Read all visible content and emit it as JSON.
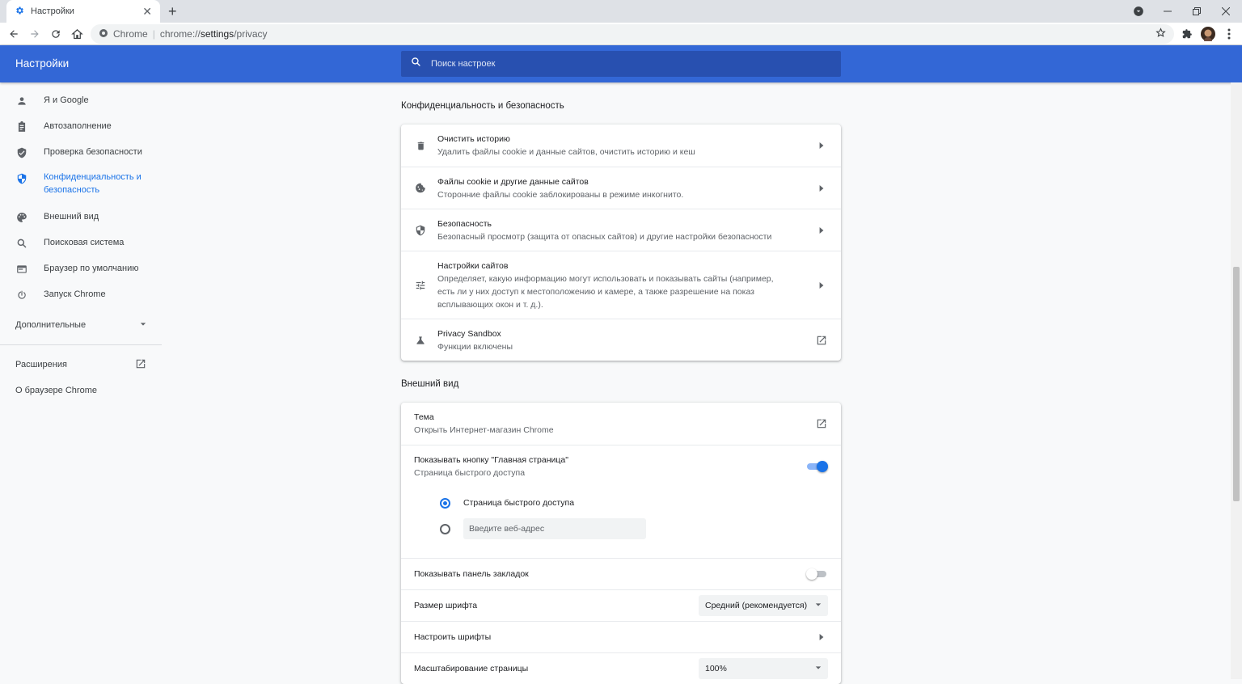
{
  "browser": {
    "tab_title": "Настройки",
    "omnibox_host": "Chrome",
    "omnibox_scheme": "chrome://",
    "omnibox_path_bold": "settings",
    "omnibox_path_rest": "/privacy"
  },
  "header": {
    "title": "Настройки",
    "search_placeholder": "Поиск настроек"
  },
  "sidebar": {
    "items": [
      {
        "label": "Я и Google",
        "icon": "person-icon"
      },
      {
        "label": "Автозаполнение",
        "icon": "clipboard-icon"
      },
      {
        "label": "Проверка безопасности",
        "icon": "shield-check-icon"
      },
      {
        "label": "Конфиденциальность и безопасность",
        "icon": "shield-icon",
        "active": true
      },
      {
        "label": "Внешний вид",
        "icon": "palette-icon"
      },
      {
        "label": "Поисковая система",
        "icon": "search-icon"
      },
      {
        "label": "Браузер по умолчанию",
        "icon": "browser-icon"
      },
      {
        "label": "Запуск Chrome",
        "icon": "power-icon"
      }
    ],
    "advanced": "Дополнительные",
    "extensions": "Расширения",
    "about": "О браузере Chrome"
  },
  "privacy": {
    "title": "Конфиденциальность и безопасность",
    "rows": [
      {
        "primary": "Очистить историю",
        "secondary": "Удалить файлы cookie и данные сайтов, очистить историю и кеш"
      },
      {
        "primary": "Файлы cookie и другие данные сайтов",
        "secondary": "Сторонние файлы cookie заблокированы в режиме инкогнито."
      },
      {
        "primary": "Безопасность",
        "secondary": "Безопасный просмотр (защита от опасных сайтов) и другие настройки безопасности"
      },
      {
        "primary": "Настройки сайтов",
        "secondary": "Определяет, какую информацию могут использовать и показывать сайты (например, есть ли у них доступ к местоположению и камере, а также разрешение на показ всплывающих окон и т. д.)."
      },
      {
        "primary": "Privacy Sandbox",
        "secondary": "Функции включены"
      }
    ]
  },
  "appearance": {
    "title": "Внешний вид",
    "theme_primary": "Тема",
    "theme_secondary": "Открыть Интернет-магазин Chrome",
    "home_primary": "Показывать кнопку \"Главная страница\"",
    "home_secondary": "Страница быстрого доступа",
    "home_toggle_on": true,
    "radio_ntp": "Страница быстрого доступа",
    "radio_url_placeholder": "Введите веб-адрес",
    "bookmarks_bar": "Показывать панель закладок",
    "bookmarks_toggle_on": false,
    "font_size_label": "Размер шрифта",
    "font_size_value": "Средний (рекомендуется)",
    "customize_fonts": "Настроить шрифты",
    "zoom_label": "Масштабирование страницы",
    "zoom_value": "100%"
  },
  "colors": {
    "accent": "#1a73e8",
    "header": "#3367d6"
  }
}
